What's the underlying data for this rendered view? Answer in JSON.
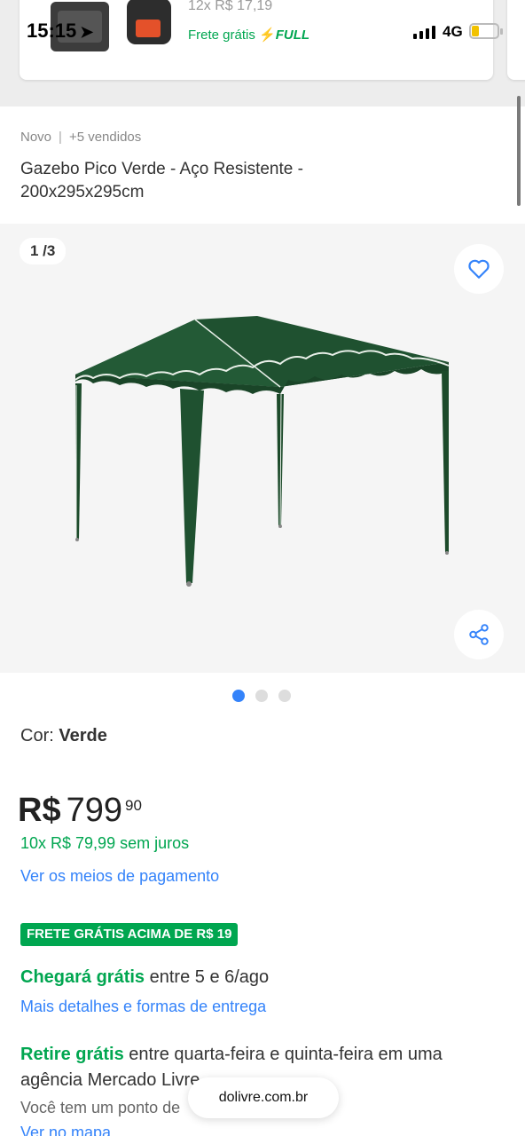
{
  "status_bar": {
    "time": "15:15",
    "network": "4G"
  },
  "previous_card": {
    "installments": "12x R$ 17,19",
    "shipping": "Frete grátis",
    "full_label": "FULL"
  },
  "product": {
    "condition": "Novo",
    "sold": "+5 vendidos",
    "title": "Gazebo Pico Verde - Aço Resistente - 200x295x295cm",
    "gallery_counter": "1 /3",
    "color_label": "Cor:",
    "color_value": "Verde"
  },
  "price": {
    "currency": "R$",
    "integer": "799",
    "cents": "90",
    "installments": "10x R$ 79,99 sem juros",
    "payment_link": "Ver os meios de pagamento"
  },
  "shipping": {
    "badge": "FRETE GRÁTIS ACIMA DE R$ 19",
    "arrive_strong": "Chegará grátis",
    "arrive_text": "entre 5 e 6/ago",
    "details_link": "Mais detalhes e formas de entrega"
  },
  "pickup": {
    "strong": "Retire grátis",
    "text": "entre quarta-feira e quinta-feira em uma agência Mercado Livre",
    "note": "Você tem um ponto de",
    "map_link": "Ver no mapa"
  },
  "browser": {
    "url": "dolivre.com.br"
  },
  "colors": {
    "accent_blue": "#3483fa",
    "green": "#00a650",
    "gazebo_green": "#1e4d2b"
  },
  "gallery": {
    "current": 1,
    "total": 3
  }
}
